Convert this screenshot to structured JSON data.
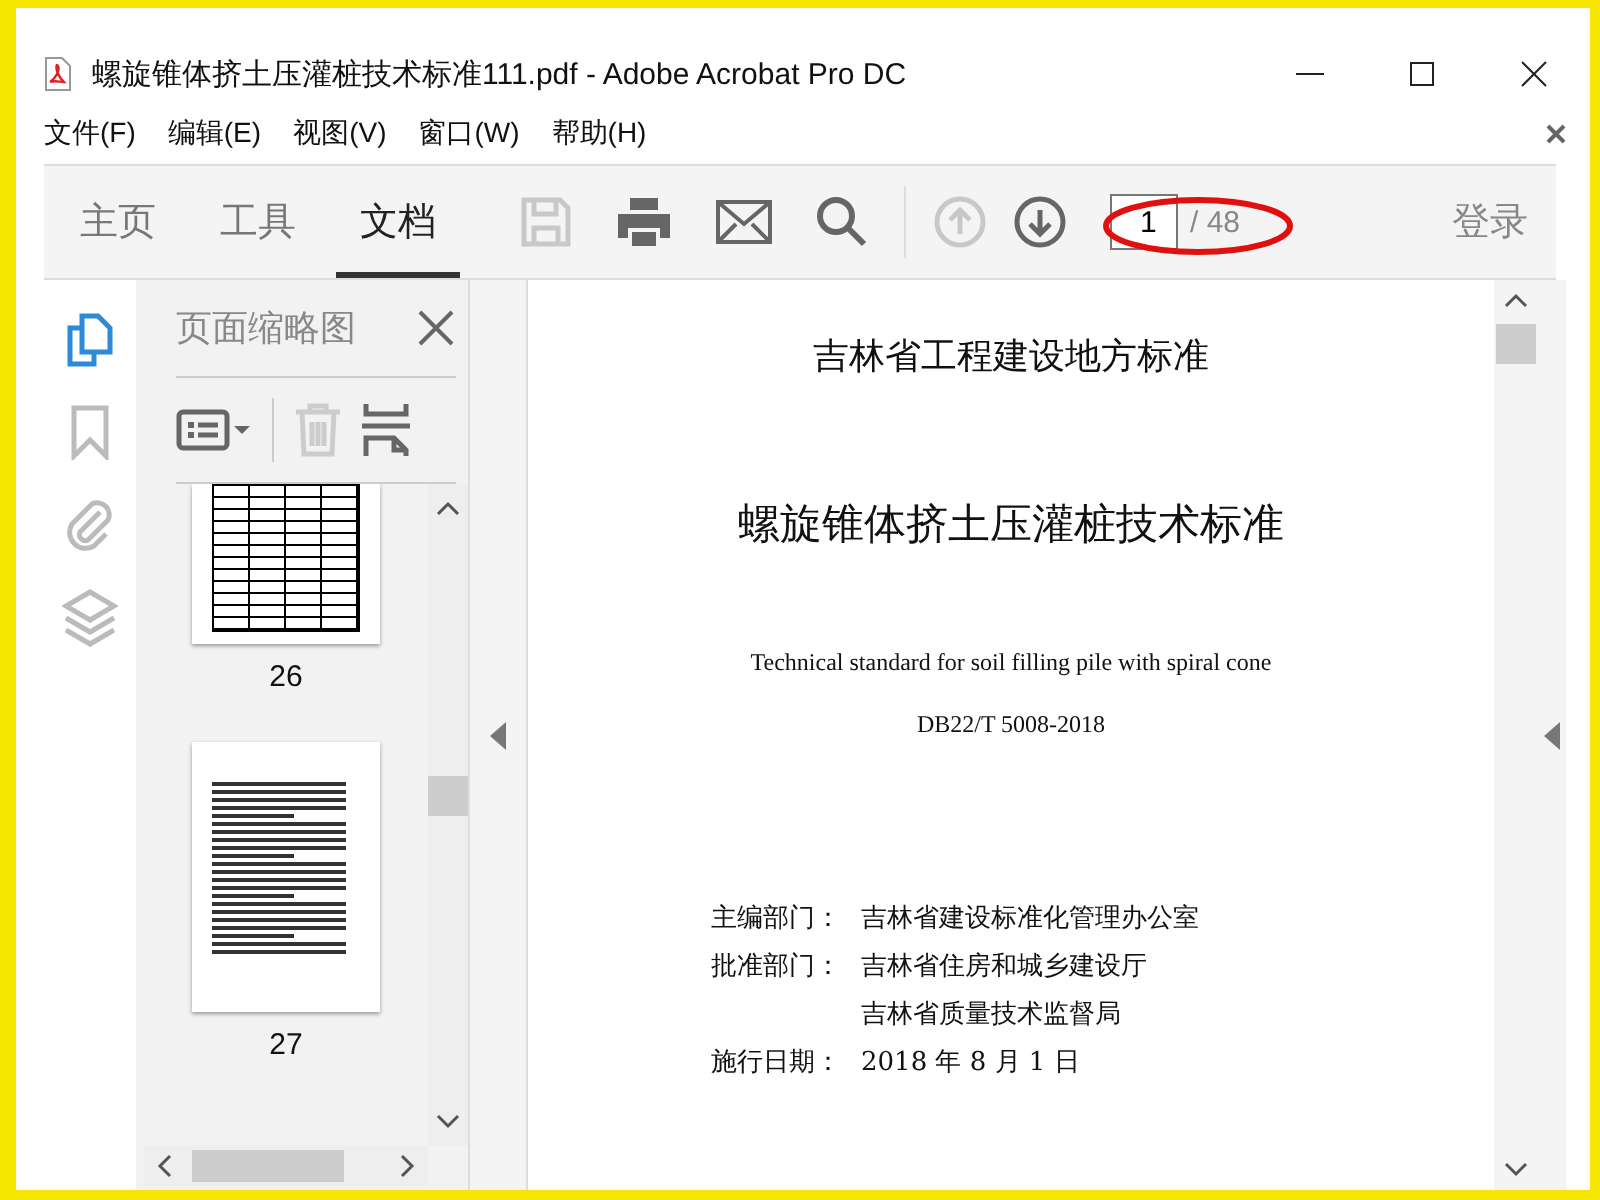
{
  "window": {
    "title": "螺旋锥体挤土压灌桩技术标准111.pdf - Adobe Acrobat Pro DC"
  },
  "menu": [
    "文件(F)",
    "编辑(E)",
    "视图(V)",
    "窗口(W)",
    "帮助(H)"
  ],
  "tabs": [
    {
      "label": "主页",
      "selected": false
    },
    {
      "label": "工具",
      "selected": false
    },
    {
      "label": "文档",
      "selected": true
    }
  ],
  "toolbar": [
    {
      "kind": "save",
      "disabled": true
    },
    {
      "kind": "print",
      "disabled": false
    },
    {
      "kind": "mail",
      "disabled": false
    },
    {
      "kind": "search",
      "disabled": false
    },
    {
      "kind": "divider"
    },
    {
      "kind": "up",
      "disabled": true
    },
    {
      "kind": "down",
      "disabled": false
    }
  ],
  "page_field": {
    "value": "1",
    "total": "/ 48"
  },
  "sign_in": "登录",
  "side_rail": [
    {
      "kind": "pages",
      "selected": true
    },
    {
      "kind": "bookmark",
      "selected": false
    },
    {
      "kind": "attach",
      "selected": false
    },
    {
      "kind": "layers",
      "selected": false
    }
  ],
  "thumbnail_panel": {
    "title": "页面缩略图",
    "thumbnails": [
      {
        "label": "26",
        "kind": "table"
      },
      {
        "label": "27",
        "kind": "text"
      }
    ]
  },
  "document": {
    "header": "吉林省工程建设地方标准",
    "title": "螺旋锥体挤土压灌桩技术标准",
    "subtitle": "Technical standard for soil filling pile with spiral cone",
    "code": "DB22/T 5008-2018",
    "info": [
      {
        "label": "主编部门：",
        "values": [
          "吉林省建设标准化管理办公室"
        ]
      },
      {
        "label": "批准部门：",
        "values": [
          "吉林省住房和城乡建设厅",
          "吉林省质量技术监督局"
        ]
      },
      {
        "label": "施行日期：",
        "values": [
          "2018 年 8 月 1 日"
        ]
      }
    ]
  }
}
